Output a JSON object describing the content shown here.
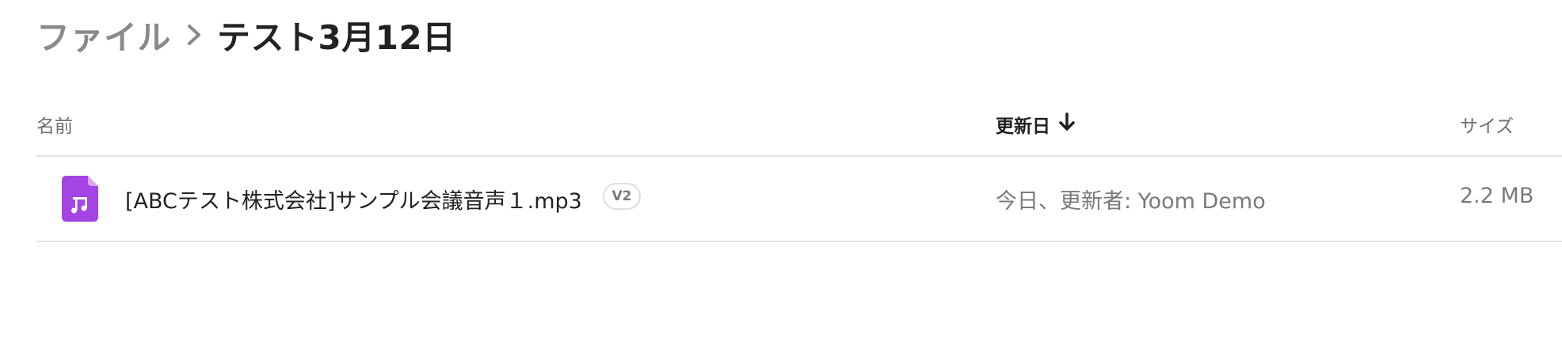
{
  "breadcrumb": {
    "parent": "ファイル",
    "current": "テスト3月12日"
  },
  "table": {
    "columns": {
      "name": "名前",
      "modified": "更新日",
      "size": "サイズ"
    },
    "sort": {
      "column": "modified",
      "direction": "descending",
      "icon": "arrow-down-icon"
    },
    "rows": [
      {
        "icon": "audio-file-icon",
        "name": "[ABCテスト株式会社]サンプル会議音声１.mp3",
        "version": "V2",
        "modified": "今日、更新者: Yoom Demo",
        "size": "2.2 MB"
      }
    ]
  },
  "colors": {
    "audio_icon": "#a444e4",
    "audio_icon_fold": "#d7a8f5",
    "divider": "#e3e3e3",
    "muted_text": "#7a7a7a"
  }
}
